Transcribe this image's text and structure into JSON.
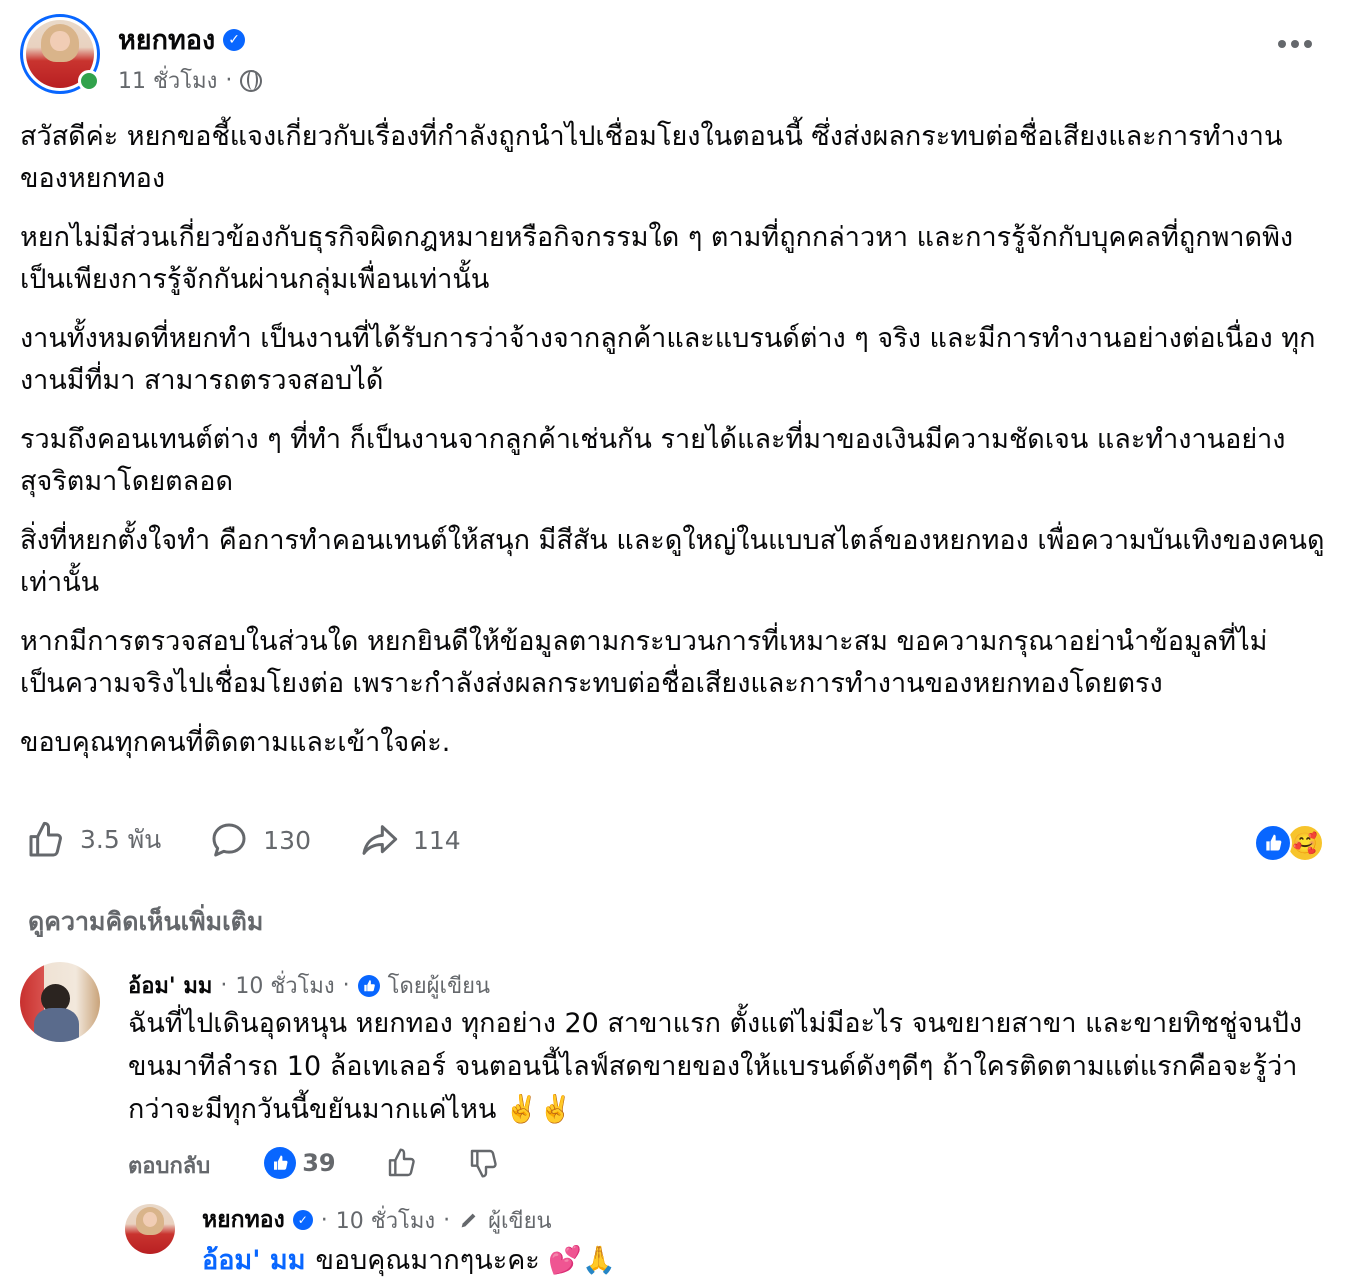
{
  "post": {
    "author": "หยกทอง",
    "time": "11 ชั่วโมง",
    "separator": "·",
    "paragraphs": [
      "สวัสดีค่ะ หยกขอชี้แจงเกี่ยวกับเรื่องที่กำลังถูกนำไปเชื่อมโยงในตอนนี้ ซึ่งส่งผลกระทบต่อชื่อเสียงและการทำงานของหยกทอง",
      "หยกไม่มีส่วนเกี่ยวข้องกับธุรกิจผิดกฎหมายหรือกิจกรรมใด ๆ ตามที่ถูกกล่าวหา และการรู้จักกับบุคคลที่ถูกพาดพิง เป็นเพียงการรู้จักกันผ่านกลุ่มเพื่อนเท่านั้น",
      "งานทั้งหมดที่หยกทำ เป็นงานที่ได้รับการว่าจ้างจากลูกค้าและแบรนด์ต่าง ๆ จริง และมีการทำงานอย่างต่อเนื่อง ทุกงานมีที่มา สามารถตรวจสอบได้",
      "รวมถึงคอนเทนต์ต่าง ๆ ที่ทำ ก็เป็นงานจากลูกค้าเช่นกัน รายได้และที่มาของเงินมีความชัดเจน และทำงานอย่างสุจริตมาโดยตลอด",
      "สิ่งที่หยกตั้งใจทำ คือการทำคอนเทนต์ให้สนุก มีสีสัน และดูใหญ่ในแบบสไตล์ของหยกทอง เพื่อความบันเทิงของคนดูเท่านั้น",
      "หากมีการตรวจสอบในส่วนใด หยกยินดีให้ข้อมูลตามกระบวนการที่เหมาะสม ขอความกรุณาอย่านำข้อมูลที่ไม่เป็นความจริงไปเชื่อมโยงต่อ เพราะกำลังส่งผลกระทบต่อชื่อเสียงและการทำงานของหยกทองโดยตรง",
      "ขอบคุณทุกคนที่ติดตามและเข้าใจค่ะ."
    ],
    "likes": "3.5 พัน",
    "comments": "130",
    "shares": "114"
  },
  "more_comments": "ดูความคิดเห็นเพิ่มเติม",
  "comment": {
    "author": "อ้อม' มม",
    "time": "10 ชั่วโมง",
    "badge": "โดยผู้เขียน",
    "text": "ฉันที่ไปเดินอุดหนุน หยกทอง ทุกอย่าง 20 สาขาแรก ตั้งแต่ไม่มีอะไร จนขยายสาขา และขายทิชชู่จนปัง ขนมาทีลำรถ 10 ล้อเทเลอร์ จนตอนนี้ไลฟ์สดขายของให้แบรนด์ดังๆดีๆ ถ้าใครติดตามแต่แรกคือจะรู้ว่ากว่าจะมีทุกวันนี้ขยันมากแค่ไหน ✌️✌️",
    "reply_label": "ตอบกลับ",
    "like_count": "39"
  },
  "reply": {
    "author": "หยกทอง",
    "time": "10 ชั่วโมง",
    "badge": "ผู้เขียน",
    "mention": "อ้อม' มม",
    "text": "ขอบคุณมากๆนะคะ 💕🙏"
  },
  "colors": {
    "accent": "#0866ff",
    "muted": "#65686c",
    "online": "#31a24c"
  }
}
